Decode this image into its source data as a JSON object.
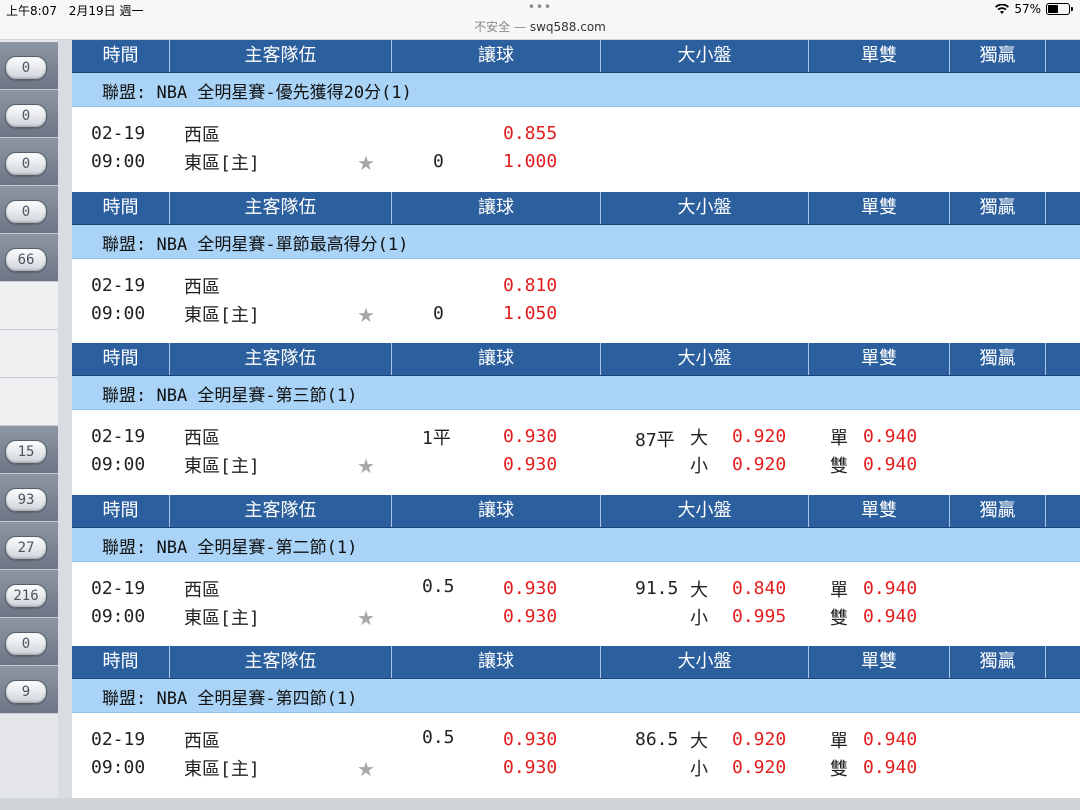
{
  "status_bar": {
    "time": "上午8:07",
    "date": "2月19日 週一",
    "url_prefix": "不安全 —",
    "url": "swq588.com",
    "dots": "•••",
    "battery": "57%",
    "wifi_icon": "wifi-icon",
    "battery_fill": 0.57
  },
  "sidebar": {
    "items": [
      "0",
      "0",
      "0",
      "0",
      "66",
      "",
      "",
      "",
      "15",
      "93",
      "27",
      "216",
      "0",
      "9"
    ]
  },
  "headers": {
    "time": "時間",
    "teams": "主客隊伍",
    "handicap": "讓球",
    "over_under": "大小盤",
    "odd_even": "單雙",
    "moneyline": "獨贏"
  },
  "blocks": [
    {
      "league": "聯盟: NBA 全明星賽-優先獲得20分(1)",
      "date": "02-19",
      "time": "09:00",
      "away": "西區",
      "home": "東區[主]",
      "line": "",
      "hcp_line_home": "0",
      "hcp_odds_away": "0.855",
      "hcp_odds_home": "1.000",
      "ou_line": "",
      "ou_over_label": "",
      "ou_under_label": "",
      "ou_over_odds": "",
      "ou_under_odds": "",
      "odd_label": "",
      "even_label": "",
      "odd_odds": "",
      "even_odds": ""
    },
    {
      "league": "聯盟: NBA 全明星賽-單節最高得分(1)",
      "date": "02-19",
      "time": "09:00",
      "away": "西區",
      "home": "東區[主]",
      "line": "",
      "hcp_line_home": "0",
      "hcp_odds_away": "0.810",
      "hcp_odds_home": "1.050",
      "ou_line": "",
      "ou_over_label": "",
      "ou_under_label": "",
      "ou_over_odds": "",
      "ou_under_odds": "",
      "odd_label": "",
      "even_label": "",
      "odd_odds": "",
      "even_odds": ""
    },
    {
      "league": "聯盟: NBA 全明星賽-第三節(1)",
      "date": "02-19",
      "time": "09:00",
      "away": "西區",
      "home": "東區[主]",
      "line": "1平",
      "hcp_line_home": "",
      "hcp_odds_away": "0.930",
      "hcp_odds_home": "0.930",
      "ou_line": "87平",
      "ou_over_label": "大",
      "ou_under_label": "小",
      "ou_over_odds": "0.920",
      "ou_under_odds": "0.920",
      "odd_label": "單",
      "even_label": "雙",
      "odd_odds": "0.940",
      "even_odds": "0.940"
    },
    {
      "league": "聯盟: NBA 全明星賽-第二節(1)",
      "date": "02-19",
      "time": "09:00",
      "away": "西區",
      "home": "東區[主]",
      "line": "0.5",
      "hcp_line_home": "",
      "hcp_odds_away": "0.930",
      "hcp_odds_home": "0.930",
      "ou_line": "91.5",
      "ou_over_label": "大",
      "ou_under_label": "小",
      "ou_over_odds": "0.840",
      "ou_under_odds": "0.995",
      "odd_label": "單",
      "even_label": "雙",
      "odd_odds": "0.940",
      "even_odds": "0.940"
    },
    {
      "league": "聯盟: NBA 全明星賽-第四節(1)",
      "date": "02-19",
      "time": "09:00",
      "away": "西區",
      "home": "東區[主]",
      "line": "0.5",
      "hcp_line_home": "",
      "hcp_odds_away": "0.930",
      "hcp_odds_home": "0.930",
      "ou_line": "86.5",
      "ou_over_label": "大",
      "ou_under_label": "小",
      "ou_over_odds": "0.920",
      "ou_under_odds": "0.920",
      "odd_label": "單",
      "even_label": "雙",
      "odd_odds": "0.940",
      "even_odds": "0.940"
    }
  ],
  "colors": {
    "header_bg": "#2c5f9e",
    "league_bg": "#a9d4f7",
    "odds_red": "#e31d1d",
    "sidebar_row": "#7a8492"
  }
}
